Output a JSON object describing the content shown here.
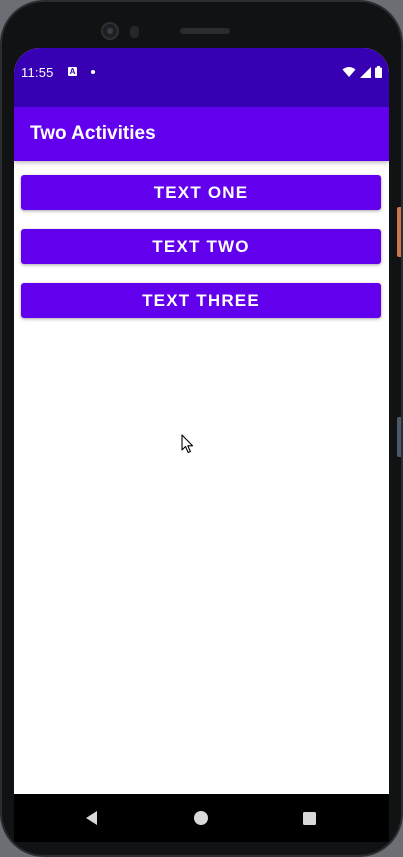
{
  "status_bar": {
    "time": "11:55",
    "notification_icon_letter": "A",
    "background_color": "#3700b3",
    "icons": [
      "wifi-icon",
      "signal-icon",
      "battery-icon"
    ]
  },
  "app_bar": {
    "title": "Two Activities",
    "background_color": "#6200ee"
  },
  "buttons": [
    {
      "label": "TEXT ONE"
    },
    {
      "label": "TEXT TWO"
    },
    {
      "label": "TEXT THREE"
    }
  ],
  "nav_bar": {
    "icons": [
      "back-icon",
      "home-icon",
      "recents-icon"
    ]
  },
  "colors": {
    "primary": "#6200ee",
    "primary_dark": "#3700b3",
    "surface": "#ffffff"
  }
}
